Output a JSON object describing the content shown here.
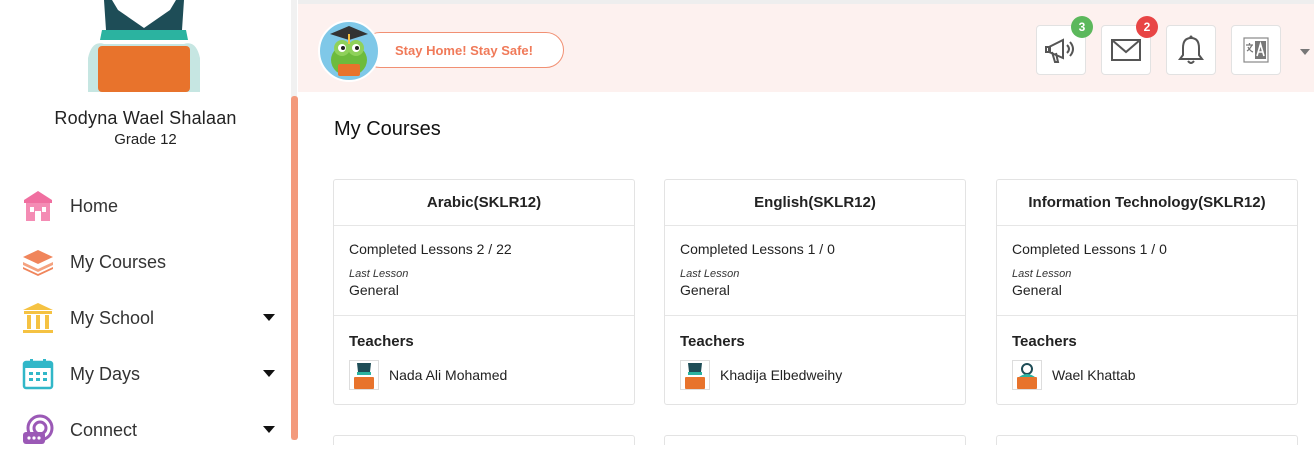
{
  "user": {
    "name": "Rodyna Wael Shalaan",
    "grade": "Grade 12"
  },
  "nav": [
    {
      "label": "Home",
      "icon": "home-icon",
      "color": "#f06fa0",
      "has_caret": false
    },
    {
      "label": "My Courses",
      "icon": "courses-icon",
      "color": "#f0855b",
      "has_caret": false
    },
    {
      "label": "My School",
      "icon": "school-icon",
      "color": "#f5c242",
      "has_caret": true
    },
    {
      "label": "My Days",
      "icon": "calendar-icon",
      "color": "#31b7c8",
      "has_caret": true
    },
    {
      "label": "Connect",
      "icon": "connect-icon",
      "color": "#9b59b6",
      "has_caret": true
    }
  ],
  "header": {
    "slogan": "Stay Home! Stay Safe!",
    "announcements_badge": "3",
    "messages_badge": "2"
  },
  "page": {
    "title": "My Courses"
  },
  "courses": [
    {
      "title": "Arabic(SKLR12)",
      "completed": "Completed Lessons 2 / 22",
      "last_lesson_label": "Last Lesson",
      "last_lesson": "General",
      "teachers_label": "Teachers",
      "teacher": "Nada Ali Mohamed"
    },
    {
      "title": "English(SKLR12)",
      "completed": "Completed Lessons 1 / 0",
      "last_lesson_label": "Last Lesson",
      "last_lesson": "General",
      "teachers_label": "Teachers",
      "teacher": "Khadija Elbedweihy"
    },
    {
      "title": "Information Technology(SKLR12)",
      "completed": "Completed Lessons 1 / 0",
      "last_lesson_label": "Last Lesson",
      "last_lesson": "General",
      "teachers_label": "Teachers",
      "teacher": "Wael Khattab"
    }
  ],
  "colors": {
    "accent": "#f07a59",
    "header_bg": "#fdf1ef",
    "avatar_orange": "#e8732c",
    "avatar_teal": "#1e4d57"
  }
}
